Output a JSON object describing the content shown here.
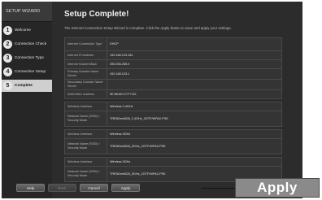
{
  "sidebar": {
    "title": "SETUP WIZARD",
    "steps": [
      {
        "num": "1",
        "label": "Welcome"
      },
      {
        "num": "2",
        "label": "Connection Check"
      },
      {
        "num": "3",
        "label": "Connection Type"
      },
      {
        "num": "4",
        "label": "Connection Setup"
      },
      {
        "num": "5",
        "label": "Complete"
      }
    ]
  },
  "main": {
    "title": "Setup Complete!",
    "intro": "The Internet Connection Setup Wizard is complete. Click the Apply button to save and apply your settings.",
    "summary": [
      {
        "label": "Internet Connection Type",
        "value": "DHCP"
      },
      {
        "label": "Internet IP Address",
        "value": "192.168.123.161"
      },
      {
        "label": "Internet Subnet Mask",
        "value": "255.255.255.0"
      },
      {
        "label": "Primary Domain Name Server",
        "value": "192.168.123.1"
      },
      {
        "label": "Secondary Domain Name Server",
        "value": ""
      },
      {
        "label": "WAN MAC Address",
        "value": "9E:65:6D:17:F7:D2"
      }
    ],
    "wireless": [
      {
        "interface_label": "Wireless Interface",
        "interface_value": "Wireless 2.4GHz",
        "net_label": "Network Name (SSID) / Security Mode",
        "net_value": "TRENDnet828_2.4GHz_2GTF/WPA2-PSK"
      },
      {
        "interface_label": "Wireless Interface",
        "interface_value": "Wireless 5GHz",
        "net_label": "Network Name (SSID) / Security Mode",
        "net_value": "TRENDnet828_5GHz_2GTF/WPA2-PSK"
      },
      {
        "interface_label": "Wireless Interface",
        "interface_value": "Wireless 5GHz",
        "net_label": "Network Name (SSID) / Security Mode",
        "net_value": "TRENDnet828_5GHz_2GTF/WPA2-PSK"
      }
    ]
  },
  "buttons": {
    "help": "Help",
    "back": "Back",
    "cancel": "Cancel",
    "apply": "Apply"
  },
  "callout": {
    "label": "Apply"
  }
}
